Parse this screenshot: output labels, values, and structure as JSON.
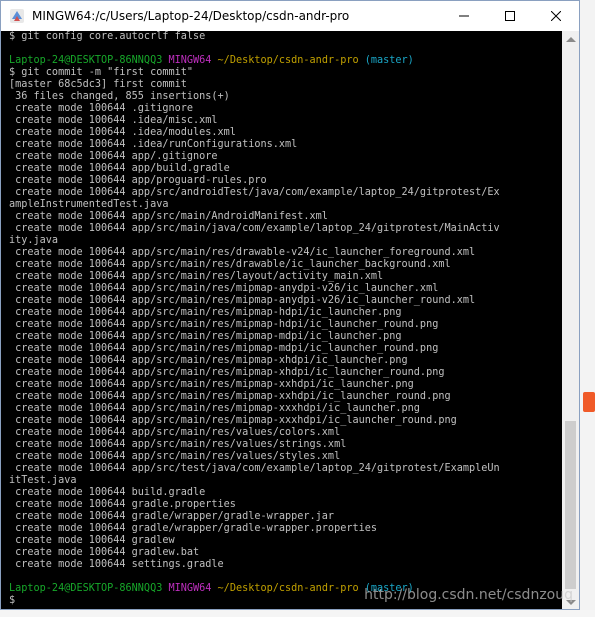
{
  "window": {
    "title": "MINGW64:/c/Users/Laptop-24/Desktop/csdn-andr-pro",
    "controls": [
      "minimize",
      "maximize",
      "close"
    ]
  },
  "colors": {
    "terminal_bg": "#000000",
    "text": "#c0c0c0",
    "prompt_user": "#17a82a",
    "prompt_env": "#bf2fbf",
    "prompt_path": "#c0a000",
    "prompt_branch": "#1aa7c8"
  },
  "terminal": {
    "lines": [
      {
        "segments": [
          {
            "text": "$ git config core.autocrlf false",
            "c": ""
          }
        ]
      },
      {
        "segments": [
          {
            "text": "",
            "c": ""
          }
        ]
      },
      {
        "segments": [
          {
            "text": "Laptop-24@DESKTOP-86NNQQ3 ",
            "c": "green"
          },
          {
            "text": "MINGW64 ",
            "c": "magenta"
          },
          {
            "text": "~/Desktop/csdn-andr-pro ",
            "c": "yellow"
          },
          {
            "text": "(master)",
            "c": "cyan"
          }
        ]
      },
      {
        "segments": [
          {
            "text": "$ git commit -m \"first commit\"",
            "c": ""
          }
        ]
      },
      {
        "segments": [
          {
            "text": "[master 68c5dc3] first commit",
            "c": ""
          }
        ]
      },
      {
        "segments": [
          {
            "text": " 36 files changed, 855 insertions(+)",
            "c": ""
          }
        ]
      },
      {
        "segments": [
          {
            "text": " create mode 100644 .gitignore",
            "c": ""
          }
        ]
      },
      {
        "segments": [
          {
            "text": " create mode 100644 .idea/misc.xml",
            "c": ""
          }
        ]
      },
      {
        "segments": [
          {
            "text": " create mode 100644 .idea/modules.xml",
            "c": ""
          }
        ]
      },
      {
        "segments": [
          {
            "text": " create mode 100644 .idea/runConfigurations.xml",
            "c": ""
          }
        ]
      },
      {
        "segments": [
          {
            "text": " create mode 100644 app/.gitignore",
            "c": ""
          }
        ]
      },
      {
        "segments": [
          {
            "text": " create mode 100644 app/build.gradle",
            "c": ""
          }
        ]
      },
      {
        "segments": [
          {
            "text": " create mode 100644 app/proguard-rules.pro",
            "c": ""
          }
        ]
      },
      {
        "segments": [
          {
            "text": " create mode 100644 app/src/androidTest/java/com/example/laptop_24/gitprotest/Ex",
            "c": ""
          }
        ]
      },
      {
        "segments": [
          {
            "text": "ampleInstrumentedTest.java",
            "c": ""
          }
        ]
      },
      {
        "segments": [
          {
            "text": " create mode 100644 app/src/main/AndroidManifest.xml",
            "c": ""
          }
        ]
      },
      {
        "segments": [
          {
            "text": " create mode 100644 app/src/main/java/com/example/laptop_24/gitprotest/MainActiv",
            "c": ""
          }
        ]
      },
      {
        "segments": [
          {
            "text": "ity.java",
            "c": ""
          }
        ]
      },
      {
        "segments": [
          {
            "text": " create mode 100644 app/src/main/res/drawable-v24/ic_launcher_foreground.xml",
            "c": ""
          }
        ]
      },
      {
        "segments": [
          {
            "text": " create mode 100644 app/src/main/res/drawable/ic_launcher_background.xml",
            "c": ""
          }
        ]
      },
      {
        "segments": [
          {
            "text": " create mode 100644 app/src/main/res/layout/activity_main.xml",
            "c": ""
          }
        ]
      },
      {
        "segments": [
          {
            "text": " create mode 100644 app/src/main/res/mipmap-anydpi-v26/ic_launcher.xml",
            "c": ""
          }
        ]
      },
      {
        "segments": [
          {
            "text": " create mode 100644 app/src/main/res/mipmap-anydpi-v26/ic_launcher_round.xml",
            "c": ""
          }
        ]
      },
      {
        "segments": [
          {
            "text": " create mode 100644 app/src/main/res/mipmap-hdpi/ic_launcher.png",
            "c": ""
          }
        ]
      },
      {
        "segments": [
          {
            "text": " create mode 100644 app/src/main/res/mipmap-hdpi/ic_launcher_round.png",
            "c": ""
          }
        ]
      },
      {
        "segments": [
          {
            "text": " create mode 100644 app/src/main/res/mipmap-mdpi/ic_launcher.png",
            "c": ""
          }
        ]
      },
      {
        "segments": [
          {
            "text": " create mode 100644 app/src/main/res/mipmap-mdpi/ic_launcher_round.png",
            "c": ""
          }
        ]
      },
      {
        "segments": [
          {
            "text": " create mode 100644 app/src/main/res/mipmap-xhdpi/ic_launcher.png",
            "c": ""
          }
        ]
      },
      {
        "segments": [
          {
            "text": " create mode 100644 app/src/main/res/mipmap-xhdpi/ic_launcher_round.png",
            "c": ""
          }
        ]
      },
      {
        "segments": [
          {
            "text": " create mode 100644 app/src/main/res/mipmap-xxhdpi/ic_launcher.png",
            "c": ""
          }
        ]
      },
      {
        "segments": [
          {
            "text": " create mode 100644 app/src/main/res/mipmap-xxhdpi/ic_launcher_round.png",
            "c": ""
          }
        ]
      },
      {
        "segments": [
          {
            "text": " create mode 100644 app/src/main/res/mipmap-xxxhdpi/ic_launcher.png",
            "c": ""
          }
        ]
      },
      {
        "segments": [
          {
            "text": " create mode 100644 app/src/main/res/mipmap-xxxhdpi/ic_launcher_round.png",
            "c": ""
          }
        ]
      },
      {
        "segments": [
          {
            "text": " create mode 100644 app/src/main/res/values/colors.xml",
            "c": ""
          }
        ]
      },
      {
        "segments": [
          {
            "text": " create mode 100644 app/src/main/res/values/strings.xml",
            "c": ""
          }
        ]
      },
      {
        "segments": [
          {
            "text": " create mode 100644 app/src/main/res/values/styles.xml",
            "c": ""
          }
        ]
      },
      {
        "segments": [
          {
            "text": " create mode 100644 app/src/test/java/com/example/laptop_24/gitprotest/ExampleUn",
            "c": ""
          }
        ]
      },
      {
        "segments": [
          {
            "text": "itTest.java",
            "c": ""
          }
        ]
      },
      {
        "segments": [
          {
            "text": " create mode 100644 build.gradle",
            "c": ""
          }
        ]
      },
      {
        "segments": [
          {
            "text": " create mode 100644 gradle.properties",
            "c": ""
          }
        ]
      },
      {
        "segments": [
          {
            "text": " create mode 100644 gradle/wrapper/gradle-wrapper.jar",
            "c": ""
          }
        ]
      },
      {
        "segments": [
          {
            "text": " create mode 100644 gradle/wrapper/gradle-wrapper.properties",
            "c": ""
          }
        ]
      },
      {
        "segments": [
          {
            "text": " create mode 100644 gradlew",
            "c": ""
          }
        ]
      },
      {
        "segments": [
          {
            "text": " create mode 100644 gradlew.bat",
            "c": ""
          }
        ]
      },
      {
        "segments": [
          {
            "text": " create mode 100644 settings.gradle",
            "c": ""
          }
        ]
      },
      {
        "segments": [
          {
            "text": "",
            "c": ""
          }
        ]
      },
      {
        "segments": [
          {
            "text": "Laptop-24@DESKTOP-86NNQQ3 ",
            "c": "green"
          },
          {
            "text": "MINGW64 ",
            "c": "magenta"
          },
          {
            "text": "~/Desktop/csdn-andr-pro ",
            "c": "yellow"
          },
          {
            "text": "(master)",
            "c": "cyan"
          }
        ]
      },
      {
        "segments": [
          {
            "text": "$ ",
            "c": ""
          }
        ]
      }
    ]
  },
  "watermark": "http://blog.csdn.net/csdnzouq"
}
